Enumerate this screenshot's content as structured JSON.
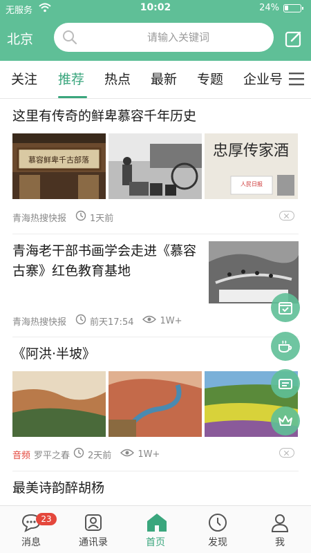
{
  "status_bar": {
    "carrier": "无服务",
    "time": "10:02",
    "battery_text": "24%",
    "battery_level": 0.24
  },
  "header": {
    "city": "北京",
    "search_placeholder": "请输入关键词"
  },
  "tabs": [
    {
      "label": "关注"
    },
    {
      "label": "推荐",
      "active": true
    },
    {
      "label": "热点"
    },
    {
      "label": "最新"
    },
    {
      "label": "专题"
    },
    {
      "label": "企业号"
    }
  ],
  "articles": [
    {
      "title": "这里有传奇的鲜卑慕容千年历史",
      "images": 3,
      "source": "青海热搜快报",
      "time": "1天前"
    },
    {
      "title": "青海老干部书画学会走进《慕容古寨》红色教育基地",
      "images": 1,
      "source": "青海热搜快报",
      "time": "前天17:54",
      "views": "1W+"
    },
    {
      "title": "《阿洪·半坡》",
      "images": 3,
      "tag": "音频",
      "source": "罗平之春",
      "time": "2天前",
      "views": "1W+"
    },
    {
      "title": "最美诗韵醉胡杨"
    }
  ],
  "image_text": {
    "plaque": "慕容鲜卑千古部落",
    "calligraphy": "忠厚传家酒",
    "small": "人民日报"
  },
  "floating_icons": [
    "calendar-check-icon",
    "coffee-cup-icon",
    "ticket-icon",
    "crown-icon"
  ],
  "bottom_nav": [
    {
      "label": "消息",
      "badge": "23",
      "icon": "chat-bubble-icon"
    },
    {
      "label": "通讯录",
      "icon": "contacts-icon"
    },
    {
      "label": "首页",
      "icon": "home-icon",
      "active": true
    },
    {
      "label": "发现",
      "icon": "compass-icon"
    },
    {
      "label": "我",
      "icon": "user-icon"
    }
  ],
  "colors": {
    "brand": "#5fbf97",
    "accent": "#3aa67d",
    "badge": "#e4473c",
    "audio_tag": "#e3463b"
  }
}
